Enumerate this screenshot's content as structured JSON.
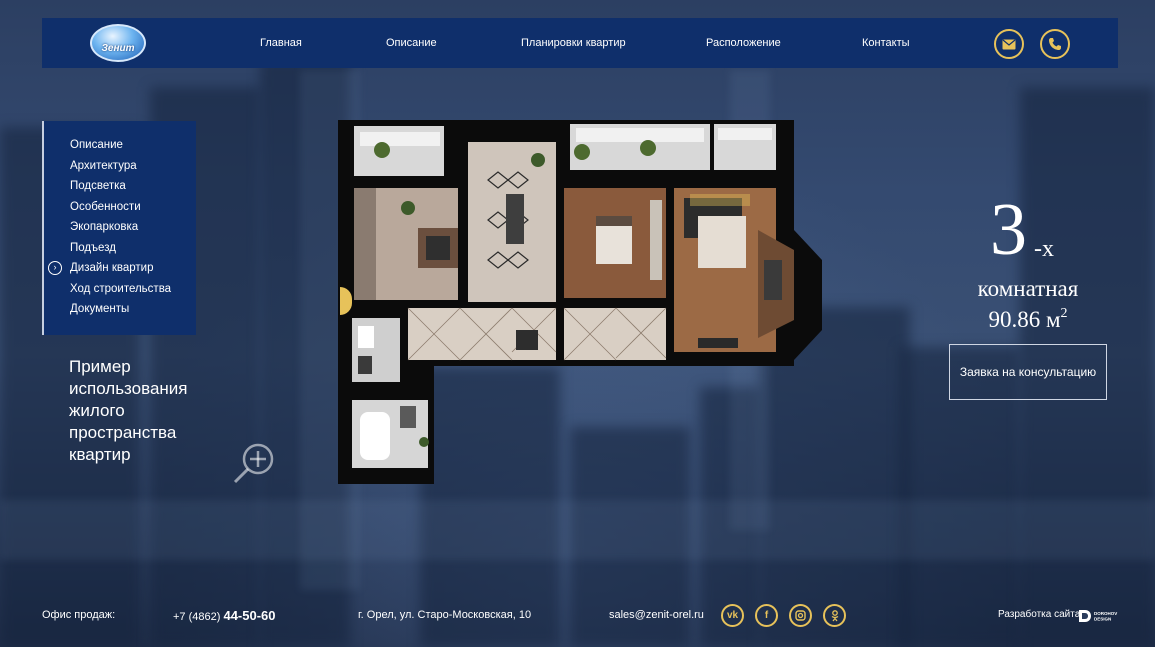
{
  "header": {
    "logo_text": "Зенит",
    "nav": [
      "Главная",
      "Описание",
      "Планировки квартир",
      "Расположение",
      "Контакты"
    ],
    "icons": [
      "mail-icon",
      "phone-icon"
    ]
  },
  "side_menu": {
    "items": [
      "Описание",
      "Архитектура",
      "Подсветка",
      "Особенности",
      "Экопарковка",
      "Подъезд",
      "Дизайн квартир",
      "Ход строительства",
      "Документы"
    ],
    "active": "Дизайн квартир"
  },
  "caption": "Пример использования жилого пространства квартир",
  "apartment": {
    "rooms_number": "3",
    "rooms_suffix": "-х",
    "type": "комнатная",
    "area": "90.86 м",
    "area_sup": "2",
    "button": "Заявка на консультацию"
  },
  "footer": {
    "office_label": "Офис продаж:",
    "phone_prefix": "+7 (4862)",
    "phone_main": "44-50-60",
    "address": "г. Орел, ул. Старо-Московская, 10",
    "email": "sales@zenit-orel.ru",
    "socials": [
      "vk-icon",
      "facebook-icon",
      "instagram-icon",
      "odnoklassniki-icon"
    ],
    "developer_label": "Разработка сайта",
    "developer_logo_text": "DOROHOV DESIGN"
  },
  "colors": {
    "header_bg": "#0f2f6b",
    "accent_gold": "#e7c25a",
    "page_bg": "#344a70"
  }
}
